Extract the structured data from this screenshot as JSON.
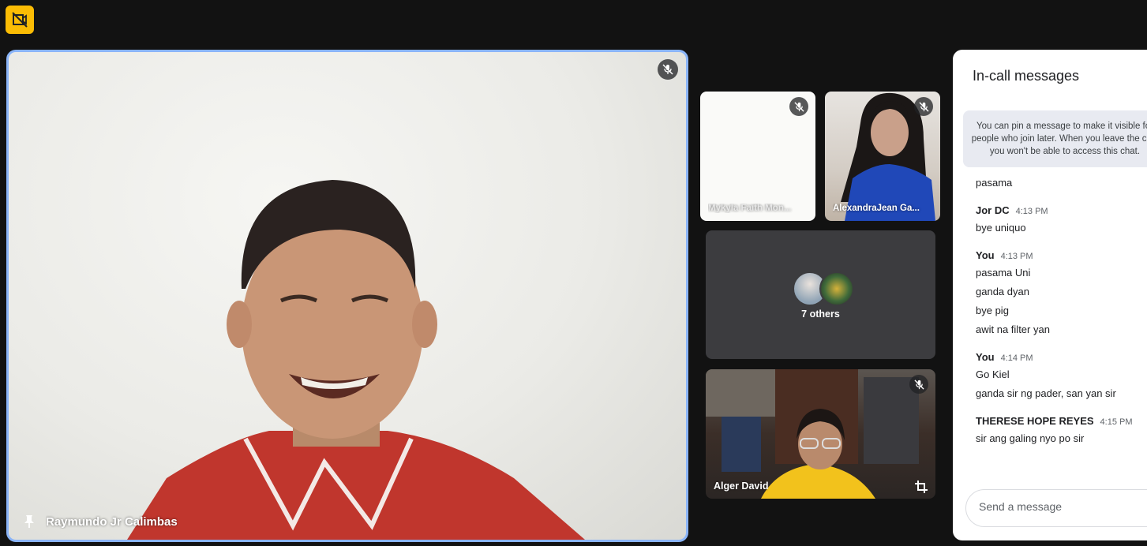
{
  "top_button": {
    "icon": "camera-off-icon"
  },
  "main_tile": {
    "name": "Raymundo Jr Calimbas",
    "pin_icon": "pin-icon",
    "mute_icon": "mic-off-icon"
  },
  "tiles": [
    {
      "name": "Mykyla Faith Mon...",
      "muted": true
    },
    {
      "name": "AlexandraJean Ga...",
      "muted": true
    },
    {
      "name": "Alger David",
      "muted": true
    }
  ],
  "others": {
    "label": "7 others"
  },
  "chat": {
    "title": "In-call messages",
    "info": "You can pin a message to make it visible for people who join later. When you leave the call, you won't be able to access this chat.",
    "groups": [
      {
        "sender": "",
        "time": "",
        "lines": [
          "pasama"
        ]
      },
      {
        "sender": "Jor DC",
        "time": "4:13 PM",
        "lines": [
          "bye uniquo"
        ]
      },
      {
        "sender": "You",
        "time": "4:13 PM",
        "lines": [
          "pasama Uni",
          "ganda dyan",
          "bye pig",
          "awit na filter yan"
        ]
      },
      {
        "sender": "You",
        "time": "4:14 PM",
        "lines": [
          "Go Kiel",
          "ganda sir ng pader, san yan sir"
        ]
      },
      {
        "sender": "THERESE HOPE REYES",
        "time": "4:15 PM",
        "lines": [
          "sir ang galing nyo po sir"
        ]
      }
    ],
    "input_placeholder": "Send a message"
  }
}
